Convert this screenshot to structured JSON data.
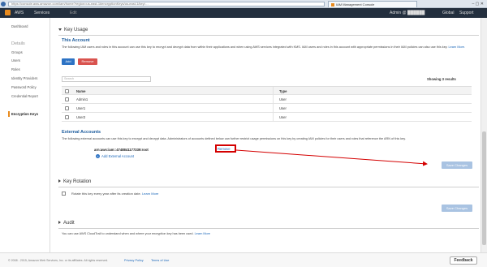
{
  "browser": {
    "url": "https://console.aws.amazon.com/iam/home?region=us-east-1#encryptionKeys/us-east-1/key/…",
    "tab_title": "IAM Management Console",
    "window_controls": "–  ▢  ✕"
  },
  "aws_bar": {
    "aws": "AWS",
    "services": "Services",
    "edit": "Edit",
    "account": "Admin @ ██████",
    "region": "Global",
    "support": "Support"
  },
  "sidebar": {
    "dashboard": "Dashboard",
    "details_heading": "Details",
    "items": [
      "Groups",
      "Users",
      "Roles",
      "Identity Providers",
      "Password Policy",
      "Credential Report"
    ],
    "encryption_keys": "Encryption Keys"
  },
  "key_usage": {
    "heading": "Key Usage",
    "this_account_title": "This Account",
    "this_account_text": "The following IAM users and roles in this account can use this key to encrypt and decrypt data from within their applications and when using AWS services integrated with KMS. IAM users and roles in this account with appropriate permissions in their IAM policies can also use this key.",
    "learn_more": "Learn More.",
    "add_button": "Add",
    "remove_button": "Remove",
    "search_placeholder": "Search",
    "showing": "Showing 3 results",
    "col_name": "Name",
    "col_type": "Type",
    "rows": [
      {
        "name": "Admin1",
        "type": "User"
      },
      {
        "name": "User1",
        "type": "User"
      },
      {
        "name": "User2",
        "type": "User"
      }
    ],
    "external_title": "External Accounts",
    "external_text": "The following external accounts can use this key to encrypt and decrypt data. Administrators of accounts defined below can further restrict usage permissions on this key by creating IAM policies for their users and roles that reference the ARN of this key.",
    "external_account": "arn:aws:iam::4748841177339:root",
    "remove_link": "Remove",
    "add_external": "Add External Account",
    "save_changes": "Save Changes"
  },
  "key_rotation": {
    "heading": "Key Rotation",
    "checkbox_label": "Rotate this key every year after its creation date.",
    "learn_more": "Learn More",
    "save_changes": "Save Changes"
  },
  "audit": {
    "heading": "Audit",
    "text": "You can use AWS CloudTrail to understand when and where your encryption key has been used.",
    "learn_more": "Learn More"
  },
  "footer": {
    "copyright": "© 2008 - 2015, Amazon Web Services, Inc. or its affiliates. All rights reserved.",
    "privacy": "Privacy Policy",
    "terms": "Terms of Use",
    "feedback": "Feedback"
  },
  "annotation_color": "#d40000"
}
